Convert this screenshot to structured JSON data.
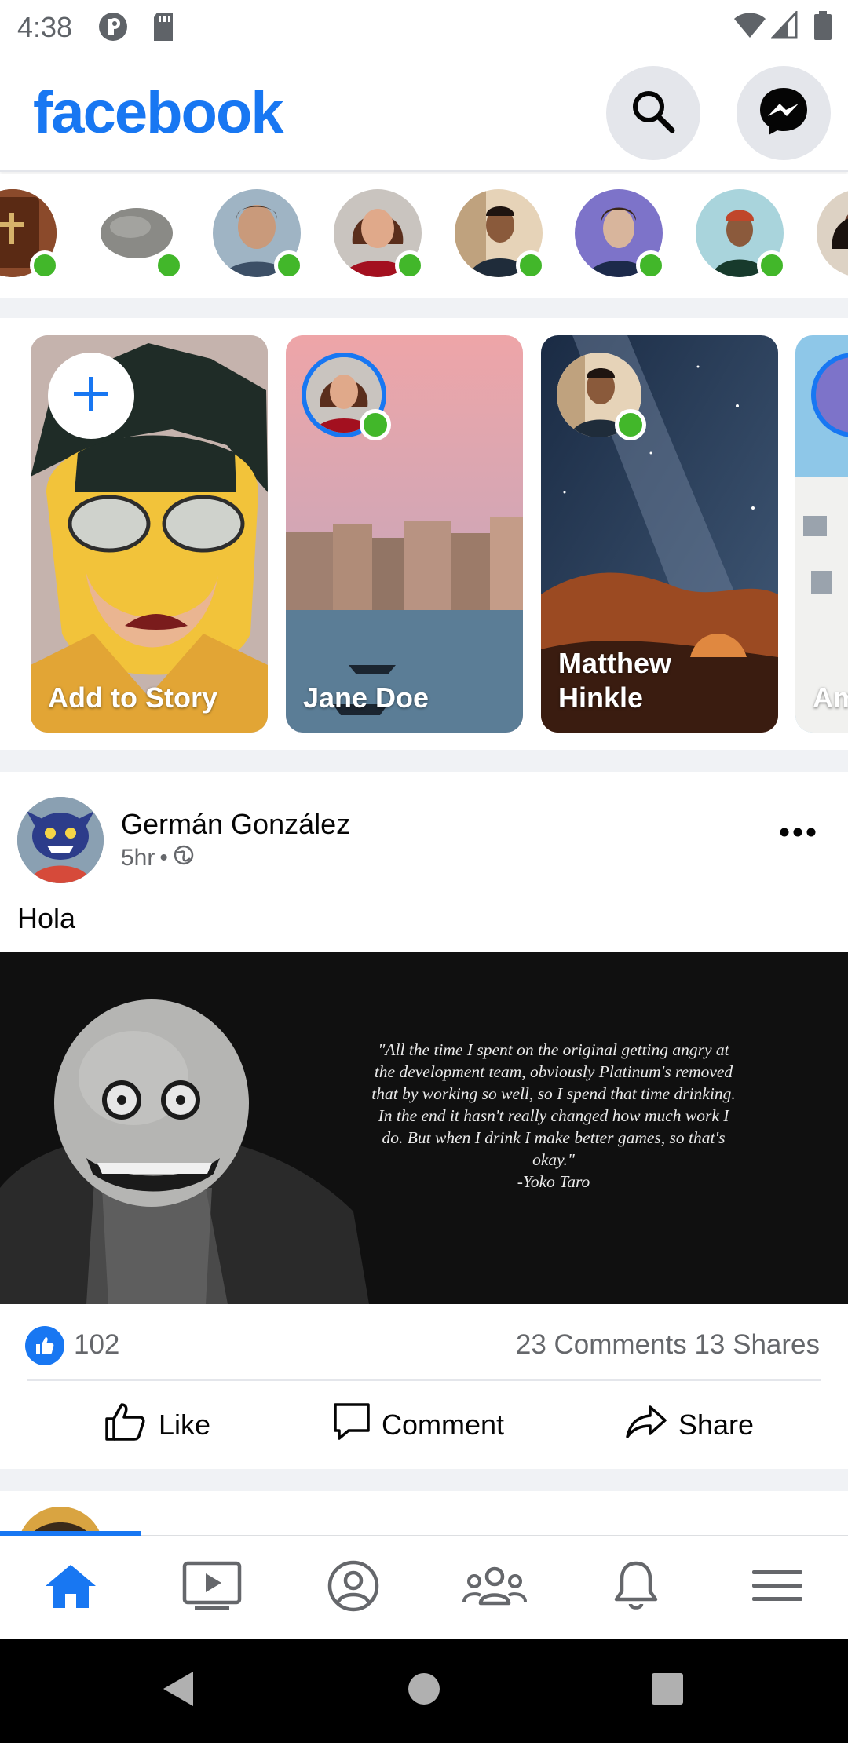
{
  "status_bar": {
    "time": "4:38",
    "icons_left": [
      "media-app-icon",
      "sd-card-icon"
    ],
    "icons_right": [
      "wifi-icon",
      "signal-icon",
      "battery-icon"
    ]
  },
  "header": {
    "logo": "facebook",
    "buttons": [
      "search-icon",
      "messenger-icon"
    ]
  },
  "colors": {
    "brand": "#1877f2",
    "online": "#42b72a",
    "muted_text": "#65676b",
    "separator": "#f0f2f5"
  },
  "stories": {
    "items": [
      {
        "label": "Add to Story",
        "type": "create"
      },
      {
        "label": "Jane Doe",
        "type": "story"
      },
      {
        "label": "Matthew Hinkle",
        "type": "story"
      },
      {
        "label": "Am",
        "type": "story"
      }
    ]
  },
  "post": {
    "author": "Germán González",
    "time": "5hr",
    "privacy_icon": "globe-icon",
    "text": "Hola",
    "image_quote": "\"All the time I spent on the original getting angry at the development team, obviously Platinum's removed that by working so well, so I spend that time drinking. In the end it hasn't really changed how much work I do. But when I drink I make better games, so that's okay.\"",
    "image_attribution": "-Yoko Taro",
    "like_count": "102",
    "comments_shares": "23 Comments 13 Shares",
    "actions": [
      "Like",
      "Comment",
      "Share"
    ]
  },
  "bottom_nav": {
    "active": "home",
    "items": [
      "home-icon",
      "watch-icon",
      "profile-icon",
      "groups-icon",
      "notifications-icon",
      "menu-icon"
    ]
  },
  "android_nav": [
    "back-icon",
    "home-circle-icon",
    "recents-icon"
  ]
}
